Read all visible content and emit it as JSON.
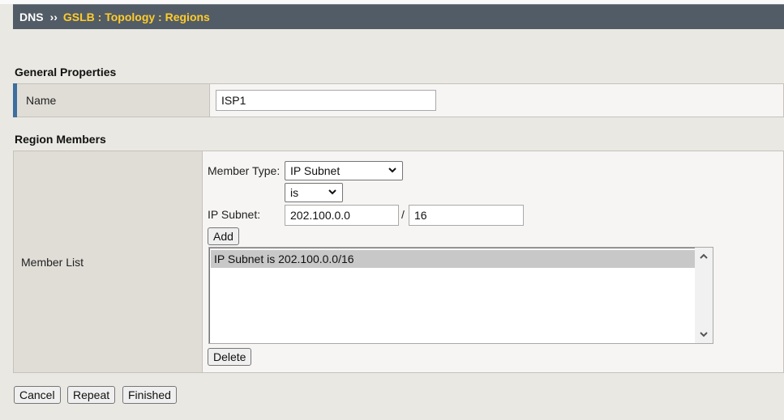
{
  "breadcrumb": {
    "root": "DNS",
    "separator": "››",
    "path": "GSLB : Topology : Regions"
  },
  "general": {
    "section_title": "General Properties",
    "name_label": "Name",
    "name_value": "ISP1"
  },
  "region_members": {
    "section_title": "Region Members",
    "member_list_label": "Member List",
    "member_type_label": "Member Type:",
    "member_type_value": "IP Subnet",
    "operator_value": "is",
    "ip_subnet_label": "IP Subnet:",
    "ip_address_value": "202.100.0.0",
    "slash": "/",
    "prefix_value": "16",
    "add_button": "Add",
    "members": [
      "IP Subnet is 202.100.0.0/16"
    ],
    "delete_button": "Delete"
  },
  "actions": {
    "cancel": "Cancel",
    "repeat": "Repeat",
    "finished": "Finished"
  },
  "colors": {
    "title_bar": "#525c66",
    "breadcrumb_accent": "#ffcc2b",
    "label_accent": "#3e6e9e",
    "selected_item": "#c8c8c8"
  }
}
